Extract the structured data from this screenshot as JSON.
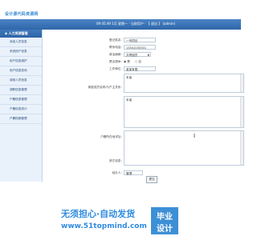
{
  "app": {
    "logo": "设计源代码资源网",
    "status_line": "09:45:49 1月 星期一 · 当前用户 ·  【 退出 】  (admin)"
  },
  "sidebar": {
    "section_title": "◆ 人力资源管理",
    "items": [
      {
        "label": "添加人员信息"
      },
      {
        "label": "系统用户信息"
      },
      {
        "label": "用户信息维护"
      },
      {
        "label": "用户信息查询"
      },
      {
        "label": "调用人员信息"
      },
      {
        "label": "调职信息管理"
      },
      {
        "label": "户籍信息管理"
      },
      {
        "label": "户籍信息统计"
      },
      {
        "label": "户籍档案管理"
      }
    ]
  },
  "form": {
    "fields": [
      {
        "label": "登记姓名：",
        "value": "一号项目"
      },
      {
        "label": "联系电话：",
        "value": "13541035301"
      },
      {
        "label": "政治面貌：",
        "value": "共青团员"
      },
      {
        "label": "是否退休：",
        "radio_yes": "是",
        "radio_no": "否"
      },
      {
        "label": "工作单位：",
        "value": "某某有限"
      },
      {
        "label": "家庭成员名称/与户主关系：",
        "value": "本省"
      },
      {
        "label": "户籍所在地详址：",
        "value": "本省"
      },
      {
        "label": "其它信息：",
        "value": ""
      },
      {
        "label": "经办人：",
        "value": "管理"
      }
    ],
    "submit_label": "提交"
  },
  "banner": {
    "line1": "无须担心·自动发货",
    "line2": "www.51topmind.com",
    "badge_top": "毕业",
    "badge_bottom": "设计"
  }
}
